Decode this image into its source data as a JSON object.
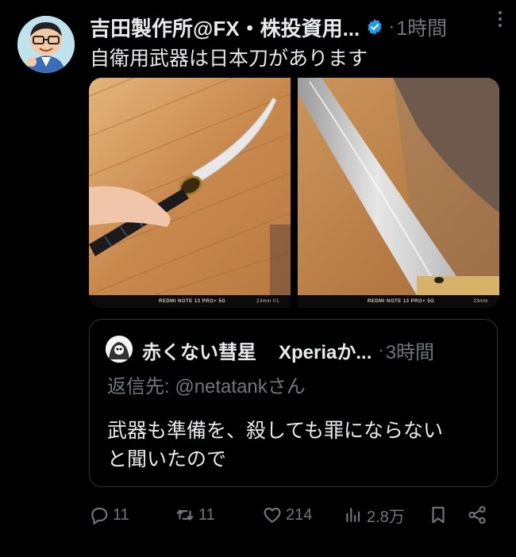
{
  "post": {
    "author": "吉田製作所@FX・株投資用...",
    "separator": "·",
    "time": "1時間",
    "text": "自衛用武器は日本刀があります",
    "media": [
      {
        "caption_brand": "REDMI NOTE 13 PRO+ 5G",
        "caption_lens": "23mm f/1"
      },
      {
        "caption_brand": "REDMI NOTE 13 PRO+ 5G",
        "caption_lens": "23mm"
      }
    ]
  },
  "quote": {
    "author": "赤くない彗星",
    "handle": "Xperiaか...",
    "separator": "·",
    "time": "3時間",
    "reply_to": "返信先: @netatankさん",
    "body_line1": "武器も準備を、殺しても罪にならない",
    "body_line2": "と聞いたので"
  },
  "actions": {
    "replies": "11",
    "reposts": "11",
    "likes": "214",
    "views": "2.8万"
  },
  "colors": {
    "background": "#000000",
    "text": "#e7e9ea",
    "muted": "#71767b",
    "verified": "#1d9bf0",
    "border": "#2f3336"
  },
  "icons": [
    "verified-badge-icon",
    "more-icon",
    "reply-icon",
    "repost-icon",
    "like-icon",
    "views-icon",
    "bookmark-icon",
    "share-icon"
  ]
}
